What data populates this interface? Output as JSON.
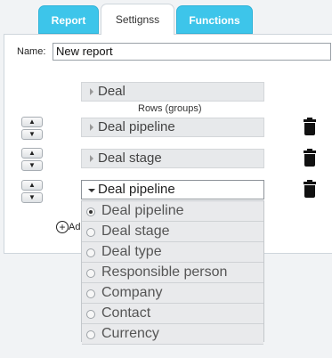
{
  "tabs": [
    {
      "label": "Report",
      "active": false
    },
    {
      "label": "Settignss",
      "active": true
    },
    {
      "label": "Functions",
      "active": false
    }
  ],
  "name_field": {
    "label": "Name:",
    "value": "New report"
  },
  "columns_group": {
    "label": "Deal"
  },
  "rows_label": "Rows (groups)",
  "rows": [
    {
      "label": "Deal pipeline"
    },
    {
      "label": "Deal stage"
    },
    {
      "label": "Deal pipeline",
      "open": true
    }
  ],
  "add_label": "Ad",
  "dropdown_options": [
    {
      "label": "Deal pipeline",
      "selected": true
    },
    {
      "label": "Deal stage",
      "selected": false
    },
    {
      "label": "Deal type",
      "selected": false
    },
    {
      "label": "Responsible person",
      "selected": false
    },
    {
      "label": "Company",
      "selected": false
    },
    {
      "label": "Contact",
      "selected": false
    },
    {
      "label": "Currency",
      "selected": false
    }
  ],
  "colors": {
    "tab_blue": "#3dc5ea",
    "panel_bg": "#ffffff",
    "option_bg": "#e9eaec"
  },
  "icons": {
    "sort": "chevron-up-down-icon",
    "delete": "trash-icon",
    "add": "plus-circle-icon"
  }
}
